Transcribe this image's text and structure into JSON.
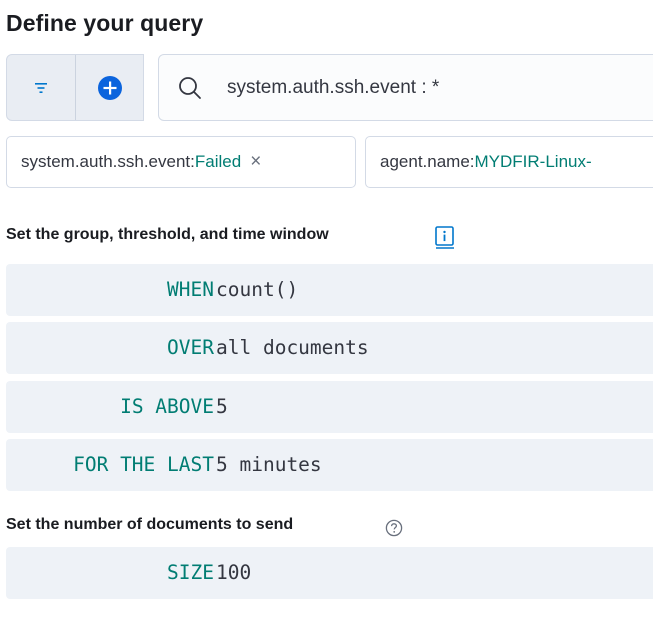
{
  "header": {
    "title": "Define your query"
  },
  "query": {
    "filter_button_icon": "filter-icon",
    "add_button_icon": "plus-circle-icon",
    "search_icon": "search-icon",
    "search_value": "system.auth.ssh.event : *"
  },
  "filters": [
    {
      "field": "system.auth.ssh.event: ",
      "value": "Failed",
      "remove": "×"
    },
    {
      "field": "agent.name: ",
      "value": "MYDFIR-Linux-"
    }
  ],
  "threshold": {
    "label": "Set the group, threshold, and time window",
    "rows": [
      {
        "keyword": "WHEN",
        "value": "count()"
      },
      {
        "keyword": "OVER",
        "value": "all documents"
      },
      {
        "keyword": "IS ABOVE",
        "value": "5"
      },
      {
        "keyword": "FOR THE LAST",
        "value": "5 minutes"
      }
    ]
  },
  "size": {
    "label": "Set the number of documents to send",
    "keyword": "SIZE",
    "value": "100"
  },
  "colors": {
    "accent": "#017d73",
    "link": "#0077cc",
    "row_bg": "#eef2f7"
  }
}
